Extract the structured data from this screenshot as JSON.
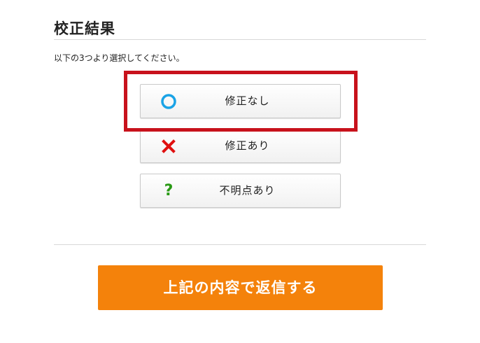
{
  "section": {
    "title": "校正結果",
    "instruction": "以下の3つより選択してください。"
  },
  "choices": [
    {
      "label": "修正なし",
      "icon": "circle-icon",
      "icon_color": "#1aa3e6"
    },
    {
      "label": "修正あり",
      "icon": "cross-icon",
      "icon_color": "#e01010"
    },
    {
      "label": "不明点あり",
      "icon": "question-icon",
      "icon_color": "#2a9a16",
      "icon_glyph": "?"
    }
  ],
  "highlight": {
    "color": "#c8121c"
  },
  "submit": {
    "label": "上記の内容で返信する",
    "color": "#f4820b"
  }
}
